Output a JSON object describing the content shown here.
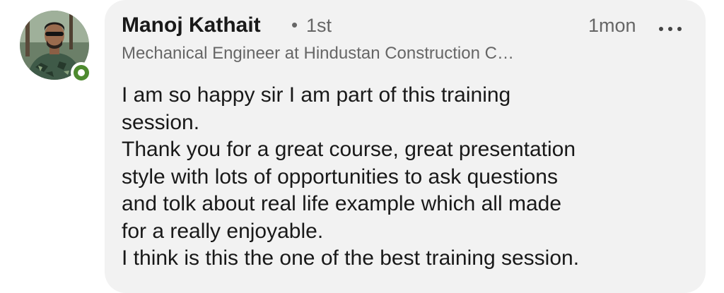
{
  "comment": {
    "author_name": "Manoj Kathait",
    "separator": "•",
    "connection_degree": "1st",
    "timestamp": "1mon",
    "more_icon": "more-horizontal-icon",
    "headline": "Mechanical Engineer at Hindustan Construction C…",
    "avatar_status": "online",
    "body_lines": [
      "I am so happy sir I am part of this training",
      "session.",
      "Thank you for a great course, great presentation",
      "style with lots of opportunities to ask questions",
      "and tolk about real life example which all made",
      "for a really enjoyable.",
      "I think is this the one of the best training session."
    ]
  },
  "colors": {
    "bubble_background": "#f2f2f2",
    "primary_text": "#191919",
    "secondary_text": "#666666",
    "presence_green": "#4e8a2f"
  }
}
